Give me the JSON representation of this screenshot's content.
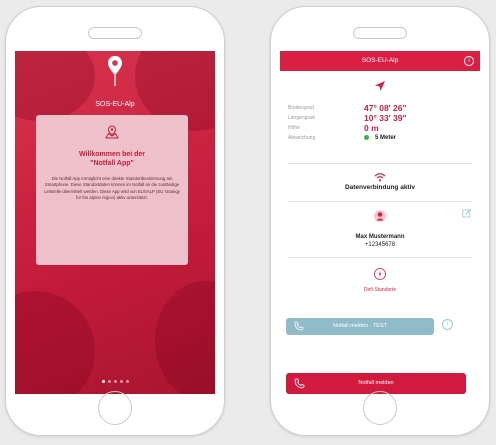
{
  "splash": {
    "app_name": "SOS-EU-Alp",
    "welcome_title_line1": "Willkommen bei der",
    "welcome_title_line2": "\"Notfall App\"",
    "welcome_text": "Die Notfall App ermöglicht eine direkte Standortbestimmung am Smartphone. Diese Standortdaten können im Notfall an die zuständige Leitstelle übermittelt werden. Diese App wird von EUSALP (EU strategy for the alpine region) aktiv unterstützt.",
    "page_dots": 5,
    "active_dot": 0
  },
  "app": {
    "title": "SOS-EU-Alp",
    "info_icon": "i",
    "location": {
      "rows": [
        {
          "label": "Breitengrad",
          "value": "47° 08' 26\""
        },
        {
          "label": "Längengrad",
          "value": "10° 33' 39\""
        },
        {
          "label": "Höhe",
          "value": "0 m"
        },
        {
          "label": "Abweichung",
          "value": "5 Meter"
        }
      ]
    },
    "connection_status": "Datenverbindung aktiv",
    "contact": {
      "name": "Max Mustermann",
      "phone": "+12345678"
    },
    "defi_label": "Defi-Standorte",
    "test_button": "Notfall melden - TEST",
    "emergency_button": "Notfall melden"
  },
  "colors": {
    "brand_red": "#d91f44",
    "status_green": "#37b24a",
    "test_blue": "#8fbcc8"
  }
}
